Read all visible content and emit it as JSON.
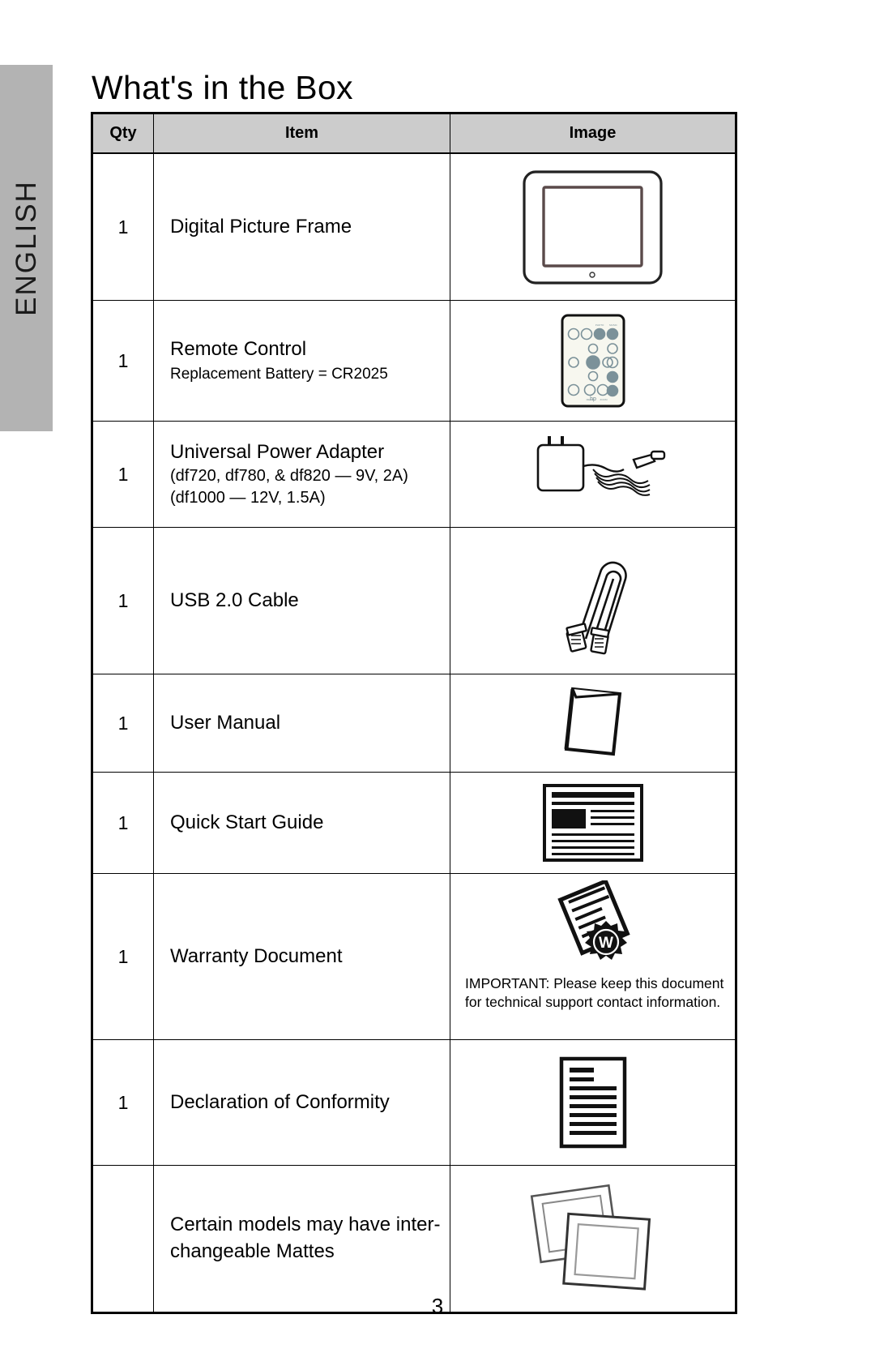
{
  "sidebar": {
    "language_tab": "ENGLISH",
    "tab_color": "#b3b3b3"
  },
  "page": {
    "title": "What's in the Box",
    "page_number": "3"
  },
  "table": {
    "header_bg": "#cccccc",
    "columns": [
      "Qty",
      "Item",
      "Image"
    ],
    "rows": [
      {
        "qty": "1",
        "item": "Digital Picture Frame",
        "item_sub": "",
        "icon": "digital-picture-frame-icon"
      },
      {
        "qty": "1",
        "item": "Remote Control",
        "item_sub": "Replacement Battery = CR2025",
        "icon": "remote-control-icon"
      },
      {
        "qty": "1",
        "item": "Universal Power Adapter",
        "item_sub_1": "(df720, df780, & df820 — 9V, 2A)",
        "item_sub_2": "(df1000 — 12V, 1.5A)",
        "icon": "power-adapter-icon"
      },
      {
        "qty": "1",
        "item": "USB 2.0 Cable",
        "item_sub": "",
        "icon": "usb-cable-icon"
      },
      {
        "qty": "1",
        "item": "User Manual",
        "item_sub": "",
        "icon": "user-manual-icon"
      },
      {
        "qty": "1",
        "item": "Quick Start Guide",
        "item_sub": "",
        "icon": "quick-start-guide-icon"
      },
      {
        "qty": "1",
        "item": "Warranty Document",
        "item_sub": "",
        "icon": "warranty-document-icon",
        "note_line_1": "IMPORTANT:  Please keep this document",
        "note_line_2": "for technical support contact information."
      },
      {
        "qty": "1",
        "item": "Declaration of Conformity",
        "item_sub": "",
        "icon": "conformity-document-icon"
      },
      {
        "qty": "",
        "item_line_1": "Certain models may have inter-",
        "item_line_2": "changeable Mattes",
        "icon": "interchangeable-mattes-icon"
      }
    ]
  }
}
